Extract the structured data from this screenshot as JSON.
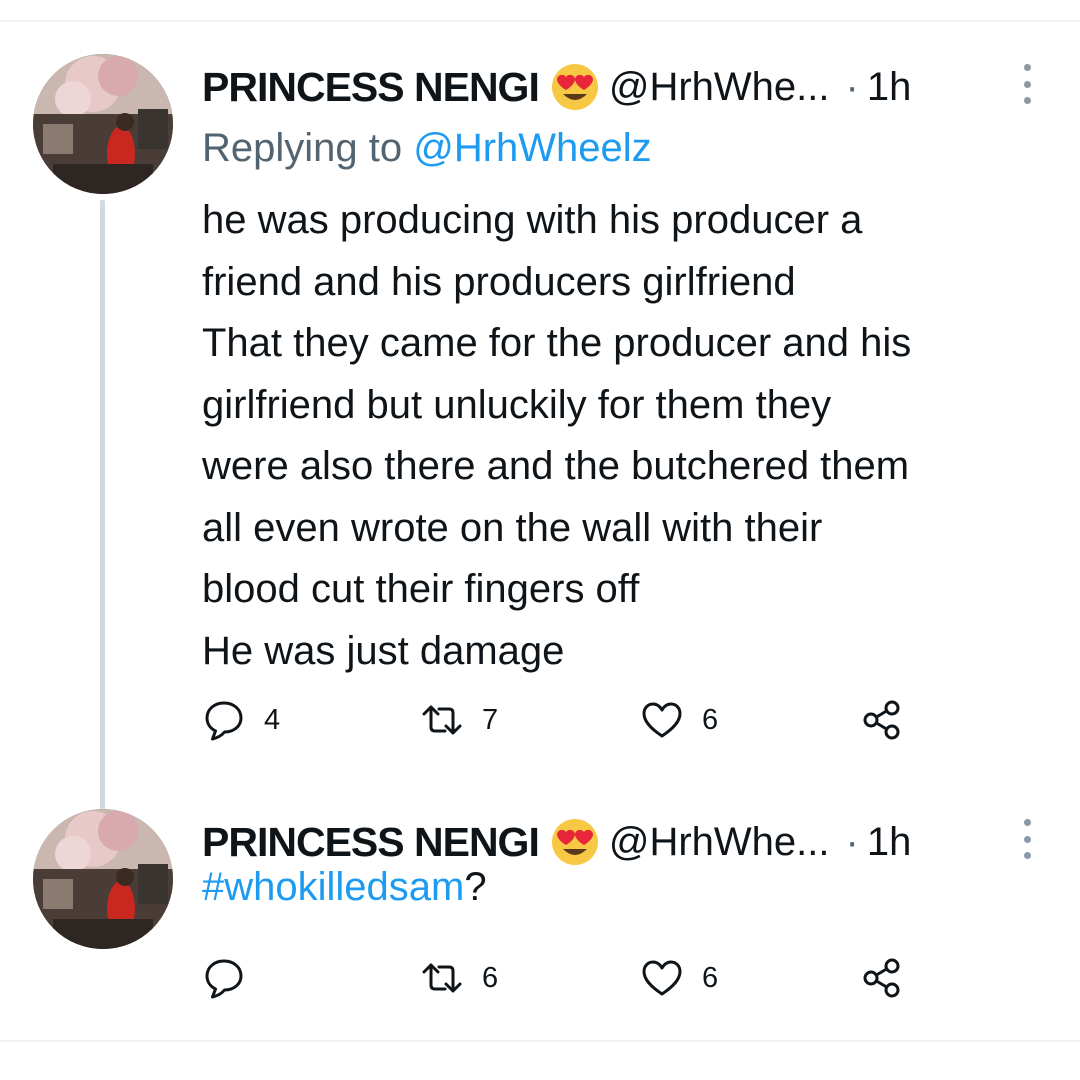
{
  "tweets": [
    {
      "display_name": "PRINCESS NENGI",
      "name_emoji": "smiling-face-with-heart-eyes",
      "handle": "@HrhWhe...",
      "separator": "·",
      "time": "1h",
      "reply_prefix": "Replying to ",
      "reply_to": "@HrhWheelz",
      "text_lines": [
        "he was producing with his producer a",
        "friend and his producers girlfriend",
        "That they came for the producer and his",
        "girlfriend but unluckily for them they",
        "were also there and the butchered them",
        "all even wrote on the wall with their",
        "blood cut their fingers off",
        "He was just damage"
      ],
      "replies": "4",
      "retweets": "7",
      "likes": "6"
    },
    {
      "display_name": "PRINCESS NENGI",
      "name_emoji": "smiling-face-with-heart-eyes",
      "handle": "@HrhWhe...",
      "separator": "·",
      "time": "1h",
      "hashtag": "#whokilledsam",
      "hashtag_suffix": "?",
      "replies": "",
      "retweets": "6",
      "likes": "6"
    }
  ],
  "colors": {
    "text": "#0f1419",
    "secondary": "#536471",
    "link": "#1d9bf0",
    "thread_line": "#cfd9de"
  },
  "icons": [
    "reply-icon",
    "retweet-icon",
    "like-icon",
    "share-icon",
    "more-icon",
    "avatar"
  ]
}
